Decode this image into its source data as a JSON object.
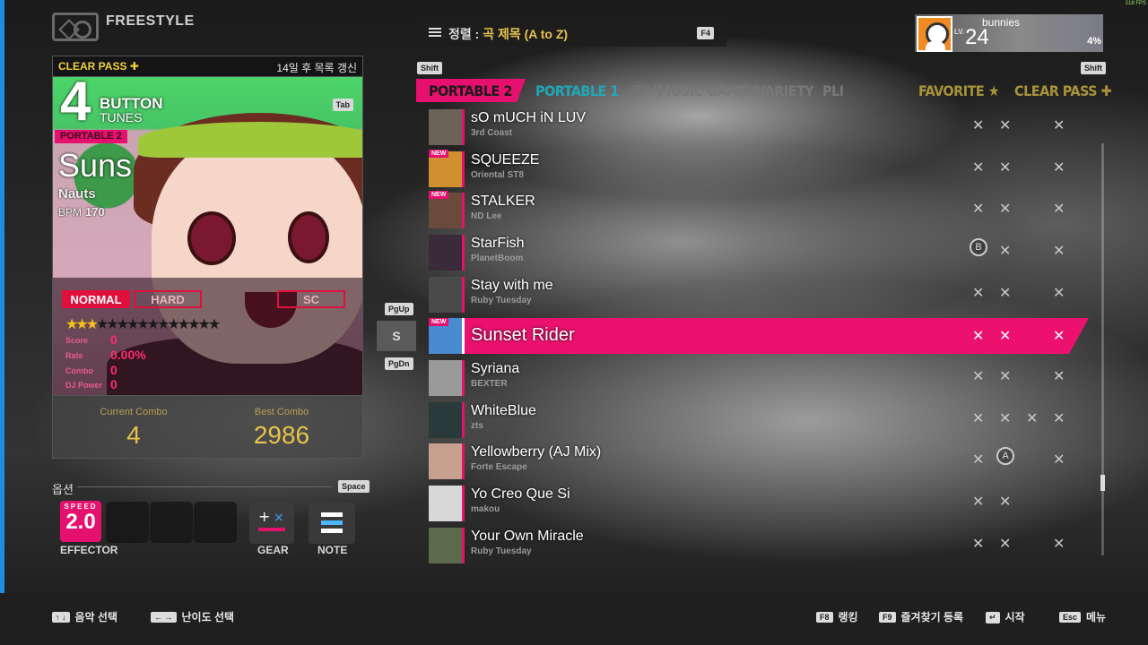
{
  "header": {
    "mode_title": "FREESTYLE"
  },
  "card": {
    "clear_pass": "CLEAR PASS ✚",
    "refresh_note": "14일 후 목록 갱신",
    "button_count": "4",
    "button_label": "BUTTON",
    "tunes_label": "TUNES",
    "tab_key": "Tab",
    "series": "PORTABLE 2",
    "title": "Suns",
    "artist": "Nauts",
    "bpm_label": "BPM",
    "bpm_value": "170",
    "difficulties": [
      "NORMAL",
      "HARD",
      "SC"
    ],
    "stars_on": "★★★",
    "stars_off": "★★★★★★★★★★★★",
    "level_stars": 3,
    "stats": [
      {
        "label": "Score",
        "value": "0"
      },
      {
        "label": "Rate",
        "value": "0.00%"
      },
      {
        "label": "Combo",
        "value": "0"
      },
      {
        "label": "DJ Power",
        "value": "0"
      }
    ],
    "current_combo_label": "Current Combo",
    "current_combo": "4",
    "best_combo_label": "Best Combo",
    "best_combo": "2986"
  },
  "options": {
    "title": "옵션",
    "space_key": "Space",
    "speed_label": "SPEED",
    "speed_value": "2.0",
    "effector_label": "EFFECTOR",
    "gear_label": "GEAR",
    "note_label": "NOTE"
  },
  "sort": {
    "prefix": "정렬 :",
    "value": "곡 제목 (A to Z)",
    "key": "F4"
  },
  "tabs": {
    "shift": "Shift",
    "items": [
      "PORTABLE 2",
      "PORTABLE 1",
      "MUSIC GAME",
      "VARIETY",
      "PLI",
      "FAVORITE ★",
      "CLEAR PASS ✚"
    ],
    "collab": "COLLAB"
  },
  "list_nav": {
    "pgup": "PgUp",
    "current_letter": "S",
    "pgdn": "PgDn"
  },
  "songs": [
    {
      "title": "sO mUCH iN LUV",
      "artist": "3rd Coast",
      "new": false
    },
    {
      "title": "SQUEEZE",
      "artist": "Oriental ST8",
      "new": true
    },
    {
      "title": "STALKER",
      "artist": "ND Lee",
      "new": true
    },
    {
      "title": "StarFish",
      "artist": "PlanetBoom",
      "new": false
    },
    {
      "title": "Stay with me",
      "artist": "Ruby Tuesday",
      "new": false
    },
    {
      "title": "Sunset Rider",
      "artist": "",
      "new": true
    },
    {
      "title": "Syriana",
      "artist": "BEXTER",
      "new": false
    },
    {
      "title": "WhiteBlue",
      "artist": "zts",
      "new": false
    },
    {
      "title": "Yellowberry (AJ Mix)",
      "artist": "Forte Escape",
      "new": false
    },
    {
      "title": "Yo Creo Que Si",
      "artist": "makou",
      "new": false
    },
    {
      "title": "Your Own Miracle",
      "artist": "Ruby Tuesday",
      "new": false
    }
  ],
  "new_badge": "NEW",
  "medal_b": "B",
  "medal_a": "A",
  "profile": {
    "name": "bunnies",
    "lv_label": "LV.",
    "level": "24",
    "percent": "4%",
    "fps": "218 FPS"
  },
  "footer": [
    {
      "key": "↑ ↓",
      "label": "음악 선택"
    },
    {
      "key": "← →",
      "label": "난이도 선택"
    },
    {
      "key": "F8",
      "label": "랭킹"
    },
    {
      "key": "F9",
      "label": "즐겨찾기 등록"
    },
    {
      "key": "↵",
      "label": "시작"
    },
    {
      "key": "Esc",
      "label": "메뉴"
    }
  ],
  "colors": {
    "accent": "#e6106e",
    "gold": "#e7c44a",
    "left_strip": "#1d8fe0"
  }
}
